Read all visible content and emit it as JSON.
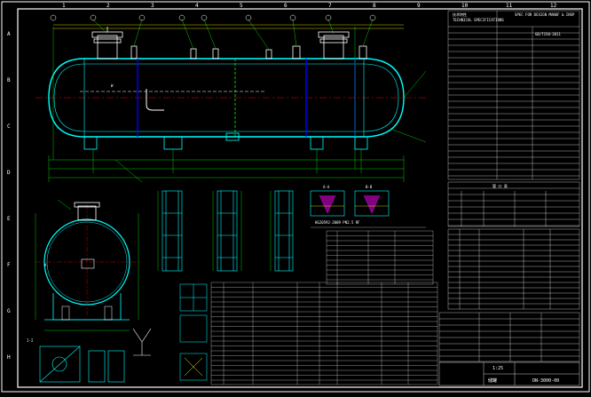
{
  "drawing": {
    "frame_cols": [
      "1",
      "2",
      "3",
      "4",
      "5",
      "6",
      "7",
      "8",
      "9",
      "10",
      "11",
      "12"
    ],
    "frame_rows": [
      "A",
      "B",
      "C",
      "D",
      "E",
      "F",
      "G",
      "H"
    ],
    "section_label_left": "I-I",
    "tech_title_cn": "技术特性",
    "tech_title_en": "TECHNICAL SPECIFICATIONS",
    "tech_title_right": "SPEC FOR DESIGN MANUF & INSP",
    "tech_code": "GB/T150-2011",
    "nozzle_table_title": "管 口 表",
    "main_title_cn": "储罐",
    "scale": "1:25",
    "drawing_no": "DN-3000-00",
    "view_label_a": "A-A",
    "view_label_b": "B-B",
    "note_text": "HG20592-2009 PN2.5 RF",
    "parts_header": "明细表"
  },
  "colors": {
    "background": "#000000",
    "outline": "#00ffff",
    "dim": "#00ff00",
    "text": "#ffffff",
    "accent": "#ff00ff",
    "hatch": "#ffff00",
    "center": "#ff0000"
  }
}
